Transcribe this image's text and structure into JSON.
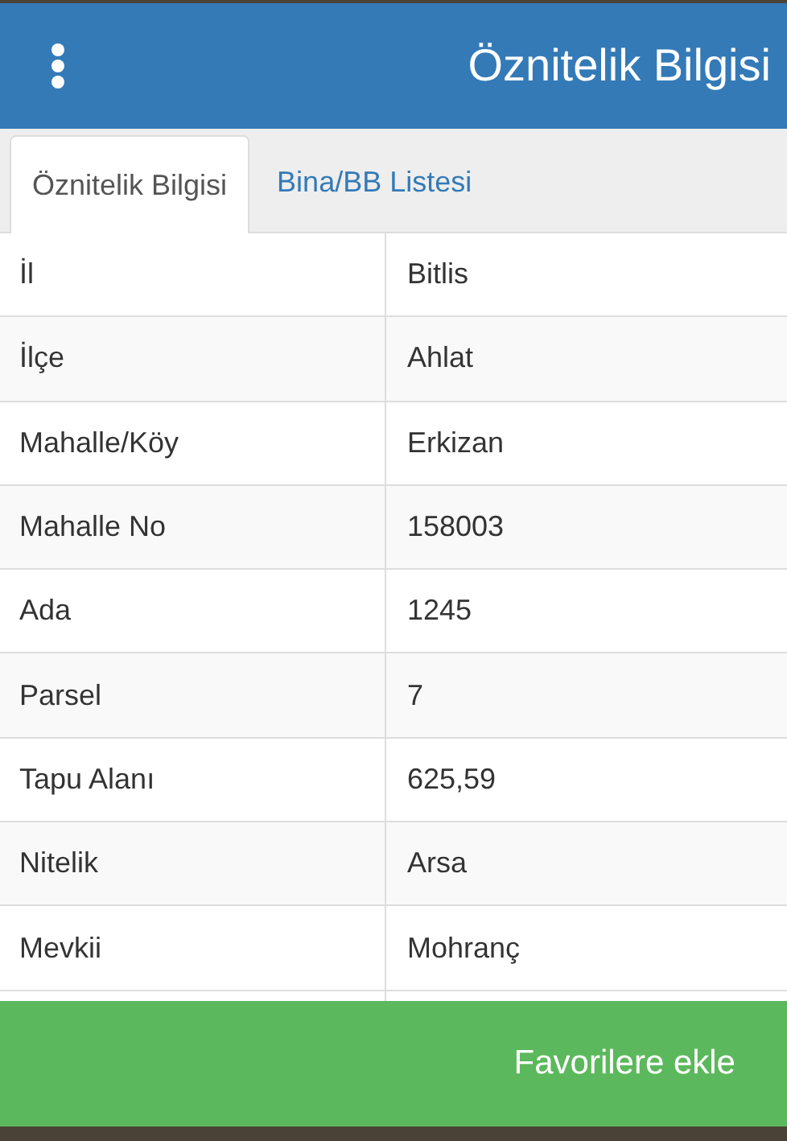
{
  "header": {
    "title": "Öznitelik Bilgisi"
  },
  "tabs": [
    {
      "label": "Öznitelik Bilgisi",
      "selected": true
    },
    {
      "label": "Bina/BB Listesi",
      "selected": false
    }
  ],
  "table": {
    "rows": [
      [
        "İl",
        "Bitlis"
      ],
      [
        "İlçe",
        "Ahlat"
      ],
      [
        "Mahalle/Köy",
        "Erkizan"
      ],
      [
        "Mahalle No",
        "158003"
      ],
      [
        "Ada",
        "1245"
      ],
      [
        "Parsel",
        "7"
      ],
      [
        "Tapu Alanı",
        "625,59"
      ],
      [
        "Nitelik",
        "Arsa"
      ],
      [
        "Mevkii",
        "Mohranç"
      ]
    ]
  },
  "action_button": {
    "label": "Favorilere ekle"
  }
}
